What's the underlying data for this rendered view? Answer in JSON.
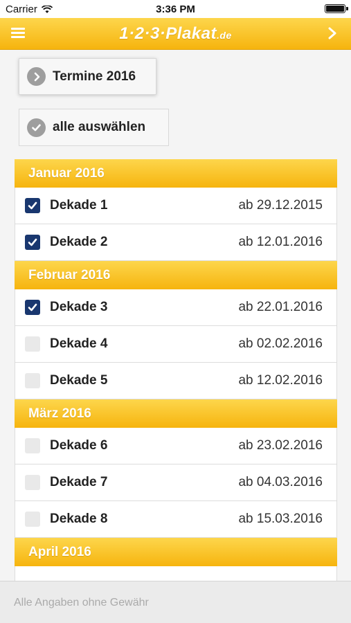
{
  "status": {
    "carrier": "Carrier",
    "time": "3:36 PM"
  },
  "header": {
    "logo_main": "1·2·3·Plakat",
    "logo_suffix": ".de"
  },
  "actions": {
    "termine_label": "Termine 2016",
    "select_all_label": "alle auswählen"
  },
  "sections": [
    {
      "month": "Januar 2016",
      "rows": [
        {
          "name": "Dekade 1",
          "date": "ab 29.12.2015",
          "checked": true
        },
        {
          "name": "Dekade 2",
          "date": "ab 12.01.2016",
          "checked": true
        }
      ]
    },
    {
      "month": "Februar 2016",
      "rows": [
        {
          "name": "Dekade 3",
          "date": "ab 22.01.2016",
          "checked": true
        },
        {
          "name": "Dekade 4",
          "date": "ab 02.02.2016",
          "checked": false
        },
        {
          "name": "Dekade 5",
          "date": "ab 12.02.2016",
          "checked": false
        }
      ]
    },
    {
      "month": "März 2016",
      "rows": [
        {
          "name": "Dekade 6",
          "date": "ab 23.02.2016",
          "checked": false
        },
        {
          "name": "Dekade 7",
          "date": "ab 04.03.2016",
          "checked": false
        },
        {
          "name": "Dekade 8",
          "date": "ab 15.03.2016",
          "checked": false
        }
      ]
    },
    {
      "month": "April 2016",
      "rows": []
    }
  ],
  "footer": {
    "disclaimer": "Alle Angaben ohne Gewähr"
  },
  "colors": {
    "accent_top": "#fdd64c",
    "accent_bottom": "#f6b40e",
    "checkbox_checked": "#19376f"
  }
}
